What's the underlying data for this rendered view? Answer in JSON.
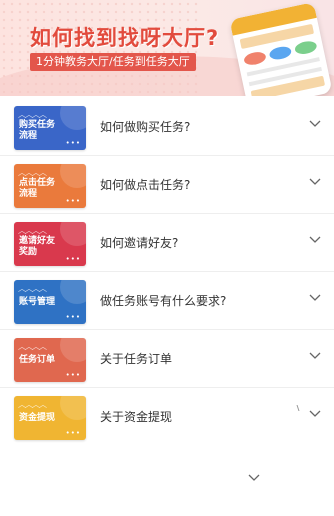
{
  "banner": {
    "title": "如何找到找呀大厅?",
    "subtitle": "1分钟教务大厅/任务到任务大厅"
  },
  "faq": {
    "items": [
      {
        "thumb_line1": "购买任务",
        "thumb_line2": "流程",
        "label": "如何做购买任务?",
        "color": "#3a66c8"
      },
      {
        "thumb_line1": "点击任务",
        "thumb_line2": "流程",
        "label": "如何做点击任务?",
        "color": "#ea7a3c"
      },
      {
        "thumb_line1": "邀请好友",
        "thumb_line2": "奖励",
        "label": "如何邀请好友?",
        "color": "#d9394d"
      },
      {
        "thumb_line1": "账号管理",
        "thumb_line2": "",
        "label": "做任务账号有什么要求?",
        "color": "#2f72c4"
      },
      {
        "thumb_line1": "任务订单",
        "thumb_line2": "",
        "label": "关于任务订单",
        "color": "#e0684f"
      },
      {
        "thumb_line1": "资金提现",
        "thumb_line2": "",
        "label": "关于资金提现",
        "color": "#f0b532"
      }
    ],
    "more_glyph": "•••",
    "wave_glyph": "︿︿︿︿"
  },
  "icons": {
    "expand": "chevron-down-icon"
  }
}
